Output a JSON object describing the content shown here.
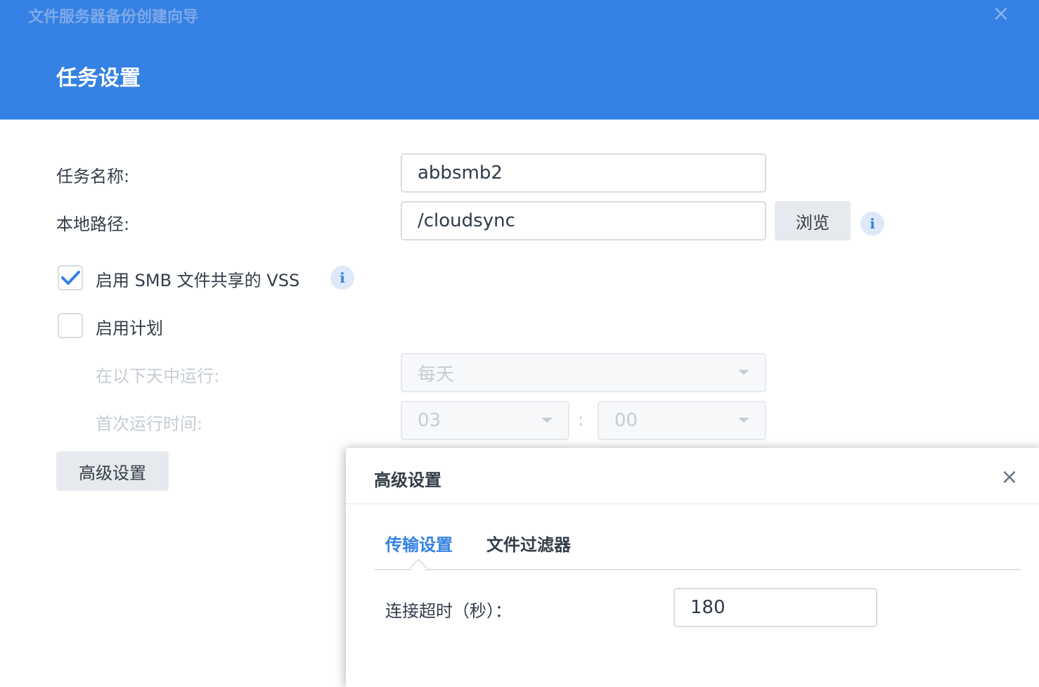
{
  "wizard": {
    "title": "文件服务器备份创建向导",
    "close_icon": "×"
  },
  "step": {
    "title": "任务设置"
  },
  "form": {
    "task_name_label": "任务名称:",
    "task_name_value": "abbsmb2",
    "local_path_label": "本地路径:",
    "local_path_value": "/cloudsync",
    "browse_label": "浏览",
    "info_icon": "i",
    "vss_label": "启用 SMB 文件共享的 VSS",
    "vss_checked": true,
    "schedule_label": "启用计划",
    "schedule_checked": false,
    "run_days_label": "在以下天中运行:",
    "run_days_value": "每天",
    "first_run_label": "首次运行时间:",
    "hour_value": "03",
    "time_separator": ":",
    "minute_value": "00",
    "advanced_button": "高级设置"
  },
  "advanced_dialog": {
    "title": "高级设置",
    "close_icon": "×",
    "tabs": [
      {
        "label": "传输设置",
        "active": true
      },
      {
        "label": "文件过滤器",
        "active": false
      }
    ],
    "timeout_label": "连接超时（秒）：",
    "timeout_value": "180"
  },
  "colors": {
    "accent": "#3581e4",
    "header_bg": "#3581e4"
  }
}
